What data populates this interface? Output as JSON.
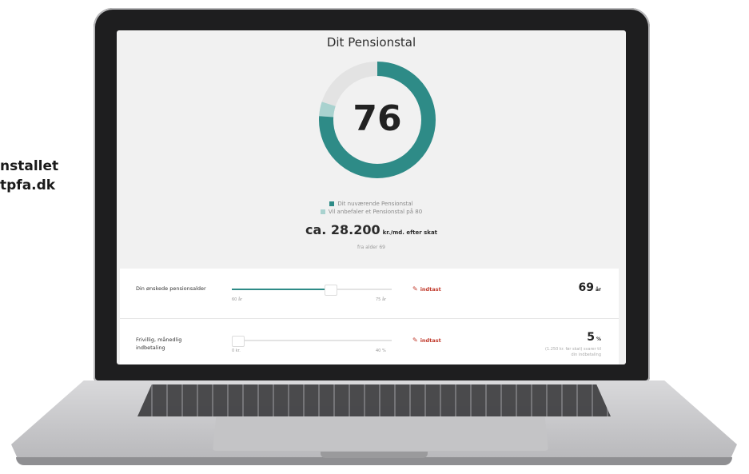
{
  "caption": {
    "line1": "nstallet",
    "line2": "tpfa.dk"
  },
  "screen": {
    "title": "Dit Pensionstal",
    "score": "76",
    "gauge": {
      "score_value": 76,
      "max": 100,
      "recommended_extra": 4
    },
    "colors": {
      "accent": "#2e8b87",
      "accent_light": "#a9d2cf",
      "track": "#e3e3e3",
      "edit": "#c0392b"
    },
    "legend": [
      {
        "label": "Dit nuværende Pensionstal",
        "color": "#2e8b87"
      },
      {
        "label": "Vil anbefaler et Pensionstal på 80",
        "color": "#a9d2cf"
      }
    ],
    "amount": {
      "value": "ca. 28.200",
      "unit": "kr./md. efter skat"
    },
    "sub": "fra alder 69",
    "rows": [
      {
        "label": "Din ønskede pensionsalder",
        "min": "60 år",
        "max": "75 år",
        "fraction": 0.6,
        "edit_icon": "pencil-icon",
        "edit_label": "indtast",
        "value": "69",
        "unit": "år",
        "note": ""
      },
      {
        "label": "Frivillig, månedlig indbetaling",
        "min": "0 kr.",
        "max": "40 %",
        "fraction": 0.02,
        "edit_icon": "pencil-icon",
        "edit_label": "indtast",
        "value": "5",
        "unit": "%",
        "note": "(1.250 kr. før skat) svarer til din indbetaling"
      }
    ]
  }
}
